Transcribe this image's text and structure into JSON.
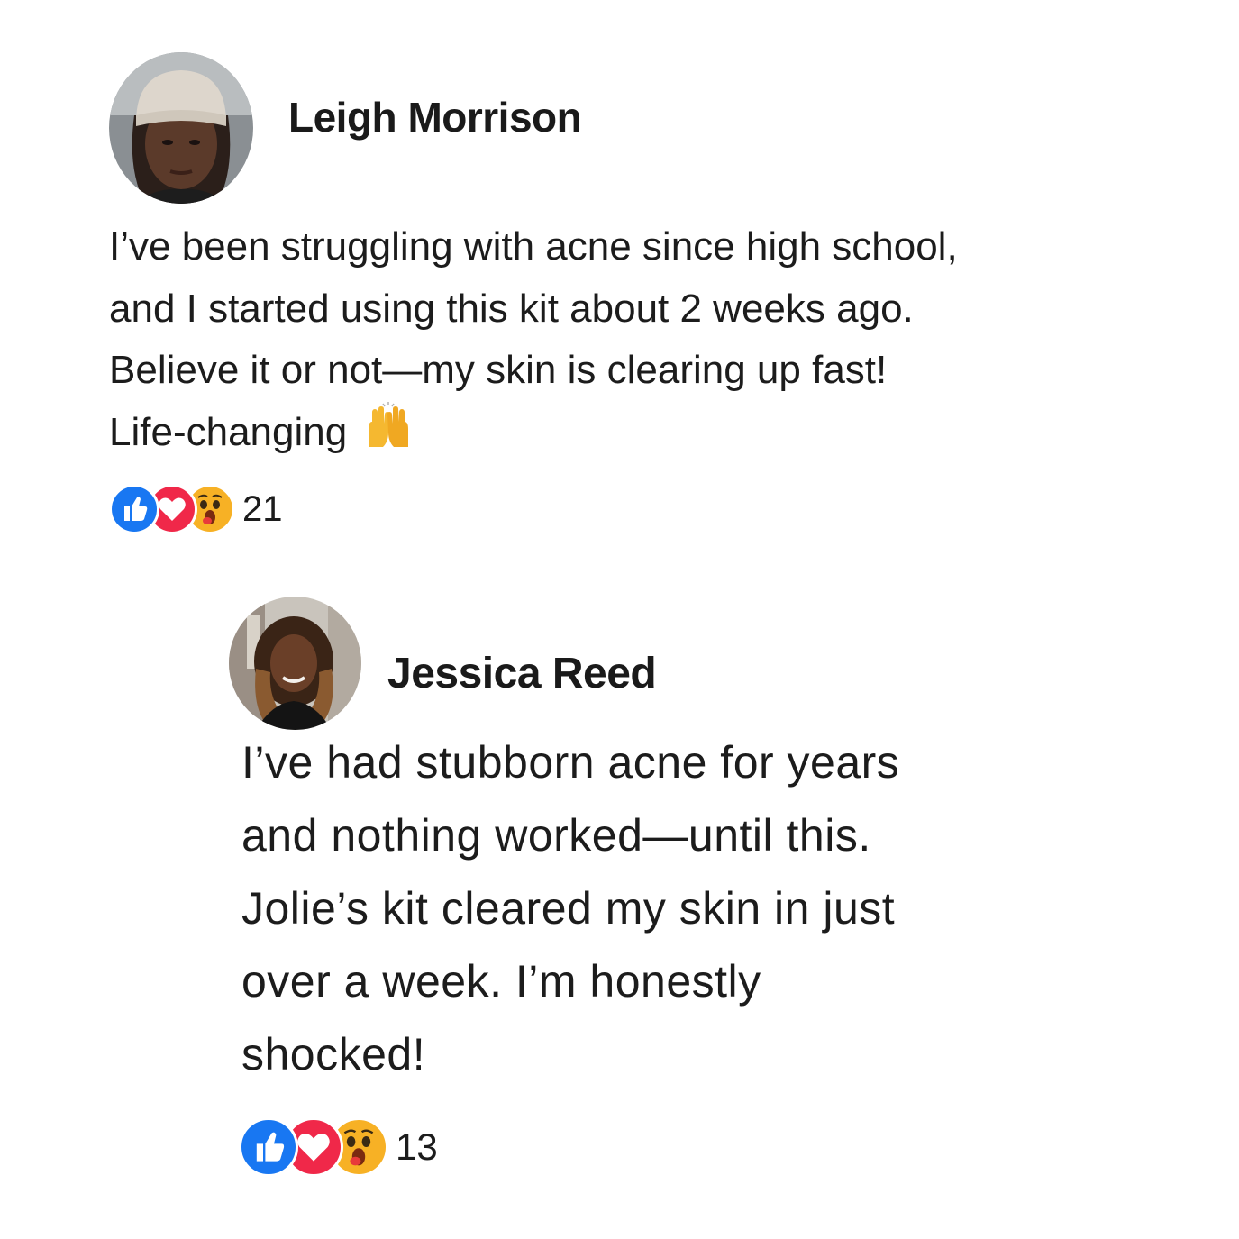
{
  "comments": [
    {
      "author": "Leigh Morrison",
      "lines": [
        "I’ve been struggling with acne since high school,",
        "and I started using this kit about 2 weeks ago.",
        "Believe it or not—my skin is clearing up fast!",
        "Life-changing"
      ],
      "emoji": "raising-hands-emoji",
      "reactions": [
        "like-reaction-icon",
        "love-reaction-icon",
        "wow-reaction-icon"
      ],
      "reaction_count": "21"
    },
    {
      "author": "Jessica Reed",
      "lines": [
        "I’ve had stubborn acne for years",
        "and nothing worked—until this.",
        "Jolie’s kit cleared my skin in just",
        "over a week. I’m honestly",
        "shocked!"
      ],
      "reactions": [
        "like-reaction-icon",
        "love-reaction-icon",
        "wow-reaction-icon"
      ],
      "reaction_count": "13"
    }
  ],
  "colors": {
    "like": "#1877F2",
    "love": "#F02849",
    "wow": "#F7B125"
  }
}
